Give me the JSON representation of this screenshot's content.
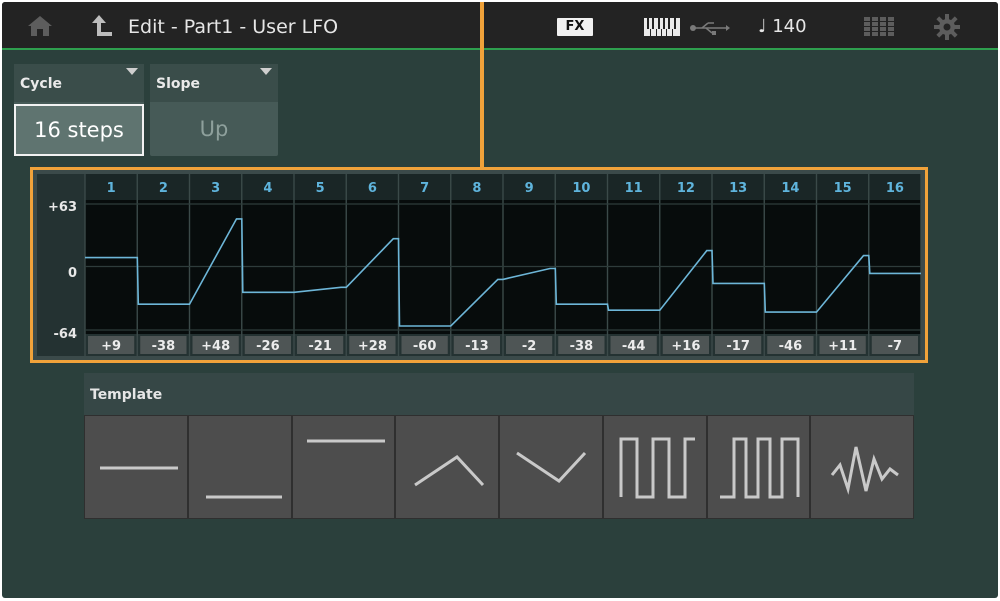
{
  "header": {
    "title": "Edit - Part1 - User LFO",
    "fx_label": "FX",
    "tempo": "♩ 140",
    "icons": [
      "home-icon",
      "back-arrow-icon",
      "keyboard-icon",
      "usb-icon",
      "grid-icon",
      "gear-icon"
    ]
  },
  "selectors": {
    "cycle": {
      "label": "Cycle",
      "value": "16 steps"
    },
    "slope": {
      "label": "Slope",
      "value": "Up"
    }
  },
  "lfo": {
    "y_labels": {
      "top": "+63",
      "mid": "0",
      "bottom": "-64"
    },
    "steps": [
      "1",
      "2",
      "3",
      "4",
      "5",
      "6",
      "7",
      "8",
      "9",
      "10",
      "11",
      "12",
      "13",
      "14",
      "15",
      "16"
    ],
    "value_labels": [
      "+9",
      "-38",
      "+48",
      "-26",
      "-21",
      "+28",
      "-60",
      "-13",
      "-2",
      "-38",
      "-44",
      "+16",
      "-17",
      "-46",
      "+11",
      "-7"
    ]
  },
  "chart_data": {
    "type": "line",
    "title": "",
    "xlabel": "",
    "ylabel": "",
    "categories": [
      "1",
      "2",
      "3",
      "4",
      "5",
      "6",
      "7",
      "8",
      "9",
      "10",
      "11",
      "12",
      "13",
      "14",
      "15",
      "16"
    ],
    "values": [
      9,
      -38,
      48,
      -26,
      -21,
      28,
      -60,
      -13,
      -2,
      -38,
      -44,
      16,
      -17,
      -46,
      11,
      -7
    ],
    "ylim": [
      -64,
      63
    ],
    "slope": "Up",
    "grid": true
  },
  "template": {
    "label": "Template",
    "buttons": [
      {
        "name": "template-mid-line-button",
        "icon": "flat-mid-icon"
      },
      {
        "name": "template-low-line-button",
        "icon": "flat-low-icon"
      },
      {
        "name": "template-high-line-button",
        "icon": "flat-high-icon"
      },
      {
        "name": "template-peak-button",
        "icon": "peak-icon"
      },
      {
        "name": "template-valley-button",
        "icon": "valley-icon"
      },
      {
        "name": "template-square-button",
        "icon": "square-wave-icon"
      },
      {
        "name": "template-square-alt-button",
        "icon": "square-wave-alt-icon"
      },
      {
        "name": "template-random-button",
        "icon": "random-wave-icon"
      }
    ]
  },
  "colors": {
    "accent": "#f0a23a",
    "wave": "#6db6d8",
    "step_number": "#5fb4dc",
    "topbar_line": "#2e9f4e"
  }
}
